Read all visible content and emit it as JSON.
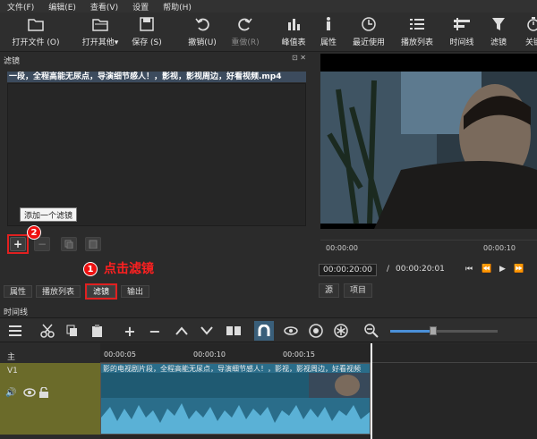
{
  "menu": [
    "文件(F)",
    "编辑(E)",
    "查看(V)",
    "设置",
    "帮助(H)"
  ],
  "toolbar": {
    "open_file": "打开文件 (O)",
    "open_other": "打开其他▾",
    "save": "保存 (S)",
    "undo": "撤销(U)",
    "redo": "重做(R)",
    "peak": "峰值表",
    "properties": "属性",
    "recent": "最近使用",
    "playlist": "播放列表",
    "timeline": "时间线",
    "filter": "滤镜",
    "keyframe": "关键"
  },
  "filters_panel": {
    "title": "滤镜",
    "controls": "⊡ ✕",
    "clip_name": "一段，全程高能无尿点，导演细节感人！，影视，影视周边，好看视频.mp4",
    "tooltip": "添加一个滤镜",
    "badge_1": "1",
    "badge_2": "2",
    "annotation": "点击滤镜"
  },
  "tabs": [
    "属性",
    "播放列表",
    "滤镜",
    "输出"
  ],
  "player": {
    "ruler": [
      "00:00:00",
      "00:00:10"
    ],
    "current_tc": "00:00:20:00",
    "sep": "/",
    "total_tc": "00:00:20:01",
    "tabs": [
      "源",
      "项目"
    ]
  },
  "timeline": {
    "title": "时间线",
    "master": "主",
    "track": "V1",
    "ruler": [
      "00:00:05",
      "00:00:10",
      "00:00:15"
    ],
    "clip_label": "影的电视剧片段，全程高能无尿点，导演细节感人！，影视，影视周边，好看视频"
  },
  "colors": {
    "accent": "#e02020",
    "clip": "#2a6d8a",
    "track_head": "#6b6b2a"
  }
}
